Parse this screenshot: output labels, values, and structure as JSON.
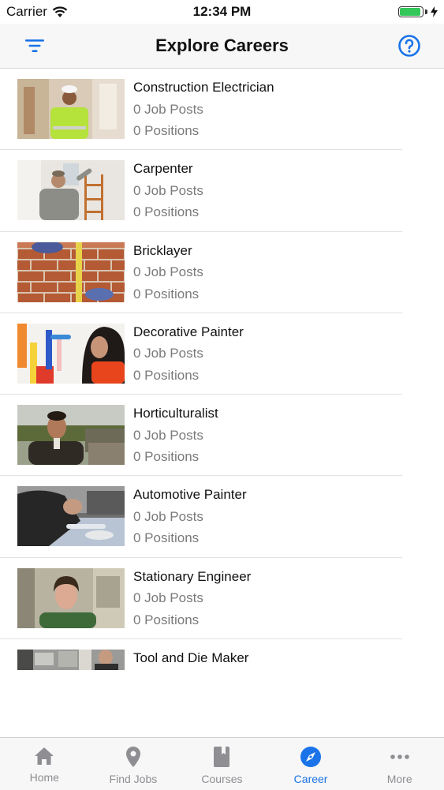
{
  "status": {
    "carrier": "Carrier",
    "time": "12:34 PM"
  },
  "navbar": {
    "title": "Explore Careers"
  },
  "careers": [
    {
      "title": "Construction Electrician",
      "job_posts": "0 Job Posts",
      "positions": "0 Positions"
    },
    {
      "title": "Carpenter",
      "job_posts": "0 Job Posts",
      "positions": "0 Positions"
    },
    {
      "title": "Bricklayer",
      "job_posts": "0 Job Posts",
      "positions": "0 Positions"
    },
    {
      "title": "Decorative Painter",
      "job_posts": "0 Job Posts",
      "positions": "0 Positions"
    },
    {
      "title": "Horticulturalist",
      "job_posts": "0 Job Posts",
      "positions": "0 Positions"
    },
    {
      "title": "Automotive Painter",
      "job_posts": "0 Job Posts",
      "positions": "0 Positions"
    },
    {
      "title": "Stationary Engineer",
      "job_posts": "0 Job Posts",
      "positions": "0 Positions"
    },
    {
      "title": "Tool and Die Maker",
      "job_posts": "",
      "positions": ""
    }
  ],
  "tabs": [
    {
      "label": "Home",
      "icon": "home-icon"
    },
    {
      "label": "Find Jobs",
      "icon": "map-pin-icon"
    },
    {
      "label": "Courses",
      "icon": "book-icon"
    },
    {
      "label": "Career",
      "icon": "compass-icon",
      "active": true
    },
    {
      "label": "More",
      "icon": "more-icon"
    }
  ],
  "colors": {
    "accent": "#1a73e8",
    "inactive": "#8e8e93",
    "battery": "#34c759"
  }
}
